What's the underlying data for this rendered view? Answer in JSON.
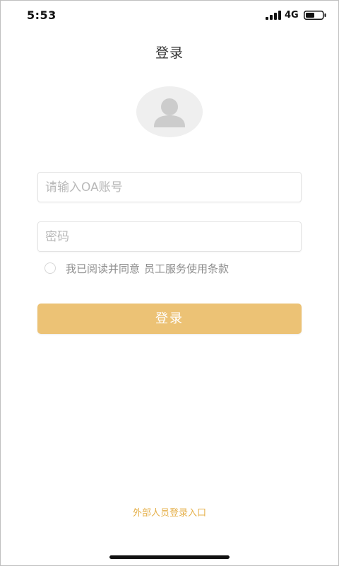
{
  "status_bar": {
    "time": "5:53",
    "network": "4G",
    "signal_icon": "signal-bars-icon",
    "battery_icon": "battery-icon"
  },
  "header": {
    "title": "登录"
  },
  "avatar": {
    "icon": "user-silhouette-icon"
  },
  "form": {
    "account_placeholder": "请输入OA账号",
    "account_value": "",
    "password_placeholder": "密码",
    "password_value": "",
    "agreement_checked": false,
    "agreement_text": "我已阅读并同意",
    "terms_link": "员工服务使用条款",
    "login_label": "登录"
  },
  "footer": {
    "external_login": "外部人员登录入口"
  },
  "colors": {
    "accent": "#ecc275",
    "link": "#e5b04a",
    "avatar_bg": "#efefef",
    "avatar_fg": "#cccccc"
  }
}
